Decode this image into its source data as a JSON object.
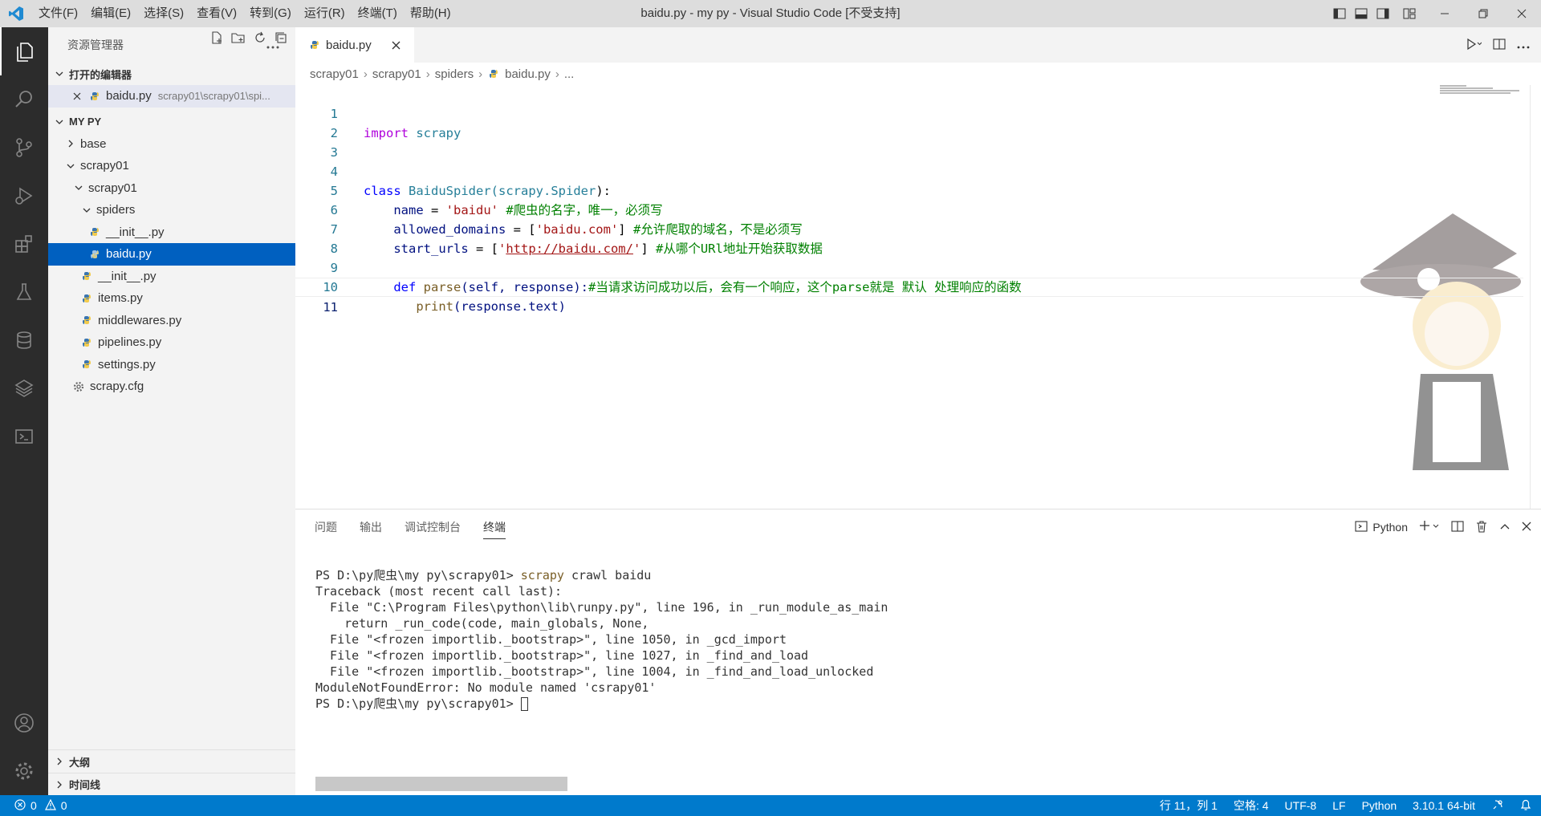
{
  "window": {
    "title": "baidu.py - my py - Visual Studio Code [不受支持]"
  },
  "menu": [
    "文件(F)",
    "编辑(E)",
    "选择(S)",
    "查看(V)",
    "转到(G)",
    "运行(R)",
    "终端(T)",
    "帮助(H)"
  ],
  "sidebar": {
    "title": "资源管理器",
    "open_editors_label": "打开的编辑器",
    "open_editor": {
      "name": "baidu.py",
      "path": "scrapy01\\scrapy01\\spi..."
    },
    "project_label": "MY PY",
    "tree": [
      {
        "label": "base"
      },
      {
        "label": "scrapy01"
      },
      {
        "label": "scrapy01"
      },
      {
        "label": "spiders"
      },
      {
        "label": "__init__.py"
      },
      {
        "label": "baidu.py"
      },
      {
        "label": "__init__.py"
      },
      {
        "label": "items.py"
      },
      {
        "label": "middlewares.py"
      },
      {
        "label": "pipelines.py"
      },
      {
        "label": "settings.py"
      },
      {
        "label": "scrapy.cfg"
      }
    ],
    "outline_label": "大纲",
    "timeline_label": "时间线"
  },
  "editor": {
    "tab_label": "baidu.py",
    "breadcrumb": [
      "scrapy01",
      "scrapy01",
      "spiders",
      "baidu.py",
      "..."
    ],
    "line_numbers": [
      "1",
      "2",
      "3",
      "4",
      "5",
      "6",
      "7",
      "8",
      "9",
      "10",
      "11"
    ],
    "code": {
      "l1_kw": "import",
      "l1_mod": " scrapy",
      "l4_kw": "class",
      "l4_name": "BaiduSpider",
      "l4_base_open": "(scrapy.",
      "l4_base_cls": "Spider",
      "l4_close": "):",
      "l5_var": "name",
      "l5_eq": " = ",
      "l5_str": "'baidu'",
      "l5_cm": " #爬虫的名字，唯一，必须写",
      "l6_var": "allowed_domains",
      "l6_eq": " = [",
      "l6_str": "'baidu.com'",
      "l6_close": "]",
      "l6_cm": " #允许爬取的域名，不是必须写",
      "l7_var": "start_urls",
      "l7_eq": " = [",
      "l7_q1": "'",
      "l7_url": "http://baidu.com/",
      "l7_q2": "'",
      "l7_close": "]",
      "l7_cm": " #从哪个URl地址开始获取数据",
      "l9_kw": "def",
      "l9_fn": "parse",
      "l9_args": "(self, response):",
      "l9_cm": "#当请求访问成功以后，会有一个响应，这个parse就是 默认 处理响应的函数",
      "l10_fn": "print",
      "l10_args": "(response.text)"
    }
  },
  "panel": {
    "tabs": [
      "问题",
      "输出",
      "调试控制台",
      "终端"
    ],
    "terminal_selector": "Python",
    "terminal": {
      "prompt1": "PS D:\\py爬虫\\my py\\scrapy01> ",
      "cmd": "scrapy",
      "cmd_rest": " crawl baidu",
      "lines": [
        "Traceback (most recent call last):",
        "  File \"C:\\Program Files\\python\\lib\\runpy.py\", line 196, in _run_module_as_main",
        "    return _run_code(code, main_globals, None,",
        "  File \"<frozen importlib._bootstrap>\", line 1050, in _gcd_import",
        "  File \"<frozen importlib._bootstrap>\", line 1027, in _find_and_load",
        "  File \"<frozen importlib._bootstrap>\", line 1004, in _find_and_load_unlocked",
        "ModuleNotFoundError: No module named 'csrapy01'"
      ],
      "prompt2": "PS D:\\py爬虫\\my py\\scrapy01> "
    }
  },
  "statusbar": {
    "errors": "0",
    "warnings": "0",
    "position": "行 11，列 1",
    "spaces": "空格: 4",
    "encoding": "UTF-8",
    "eol": "LF",
    "language": "Python",
    "interpreter": "3.10.1 64-bit"
  },
  "colors": {
    "accent": "#007acc",
    "selection": "#0060c0",
    "activitybar": "#2c2c2c"
  }
}
